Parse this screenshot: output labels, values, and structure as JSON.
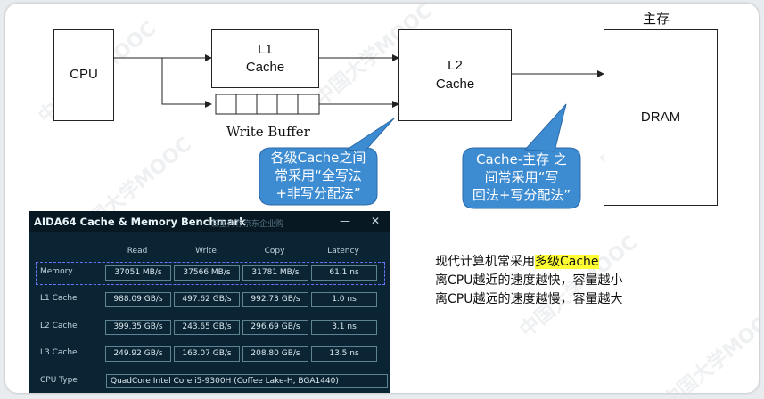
{
  "diagram": {
    "cpu_label": "CPU",
    "l1_label": "L1\nCache",
    "l2_label": "L2\nCache",
    "dram_label": "DRAM",
    "main_memory_label": "主存",
    "write_buffer_label": "Write Buffer",
    "bubble_left_text": "各级Cache之间\n常采用“全写法\n+非写分配法”",
    "bubble_right_text": "Cache-主存 之\n间常采用“写\n回法+写分配法”",
    "bubble_color": "#3d8bd1"
  },
  "aida": {
    "title": "AIDA64 Cache & Memory Benchmark",
    "subtitle": "三星内存京东企业购",
    "minimize": "—",
    "close": "✕",
    "headers": [
      "Read",
      "Write",
      "Copy",
      "Latency"
    ],
    "rows": [
      {
        "label": "Memory",
        "values": [
          "37051 MB/s",
          "37566 MB/s",
          "31781 MB/s",
          "61.1 ns"
        ]
      },
      {
        "label": "L1 Cache",
        "values": [
          "988.09 GB/s",
          "497.62 GB/s",
          "992.73 GB/s",
          "1.0 ns"
        ]
      },
      {
        "label": "L2 Cache",
        "values": [
          "399.35 GB/s",
          "243.65 GB/s",
          "296.69 GB/s",
          "3.1 ns"
        ]
      },
      {
        "label": "L3 Cache",
        "values": [
          "249.92 GB/s",
          "163.07 GB/s",
          "208.80 GB/s",
          "13.5 ns"
        ]
      }
    ],
    "cpu_type_label": "CPU Type",
    "cpu_type_value": "QuadCore Intel Core i5-9300H  (Coffee Lake-H, BGA1440)"
  },
  "note": {
    "line1_prefix": "现代计算机常采用",
    "line1_highlight": "多级Cache",
    "line2": "离CPU越近的速度越快，容量越小",
    "line3": "离CPU越远的速度越慢，容量越大"
  },
  "watermark": "中国大学MOOC"
}
